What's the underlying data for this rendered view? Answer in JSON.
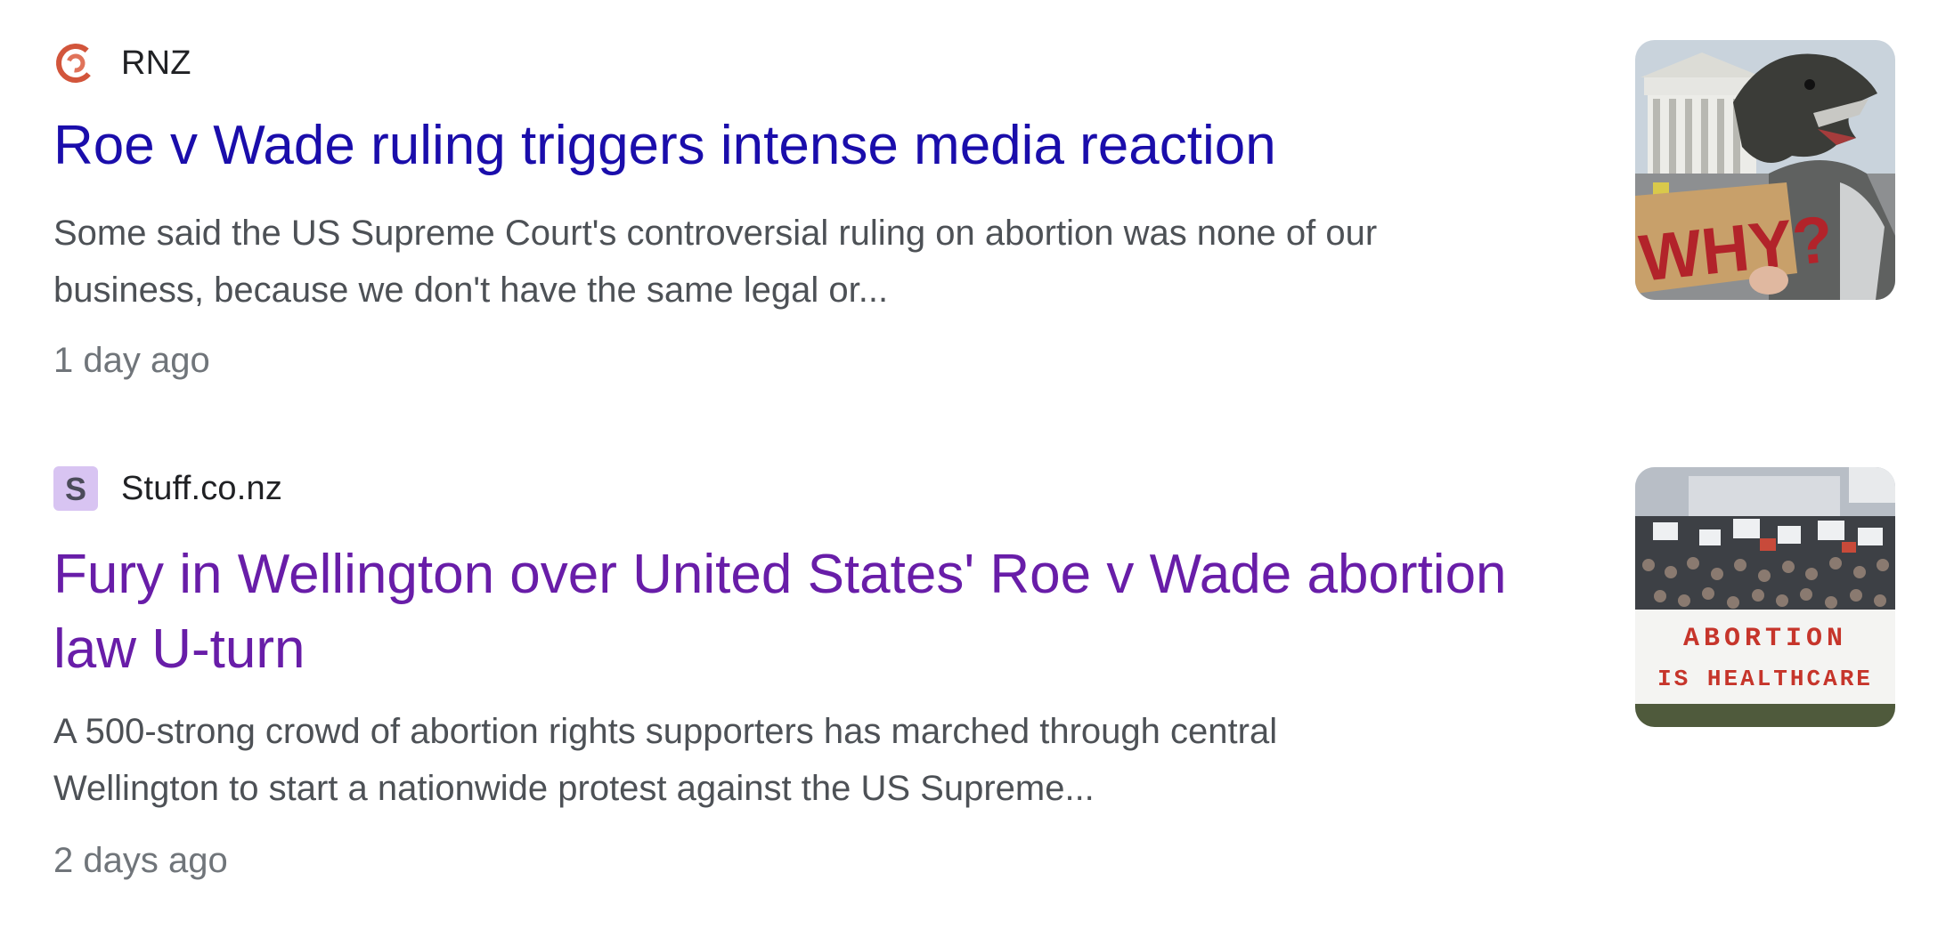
{
  "results": [
    {
      "source": "RNZ",
      "favicon": "rnz-swirl-icon",
      "headline": "Roe v Wade ruling triggers intense media reaction",
      "snippet_line1": "Some said the US Supreme Court's controversial ruling on abortion was none of our",
      "snippet_line2": "business, because we don't have the same legal or...",
      "age": "1 day ago",
      "thumbnail": {
        "icon": "protest-dinosaur-thumbnail",
        "sign_text": "WHY?"
      }
    },
    {
      "source": "Stuff.co.nz",
      "favicon": "stuff-s-icon",
      "headline_line1": "Fury in Wellington over United States' Roe v Wade abortion",
      "headline_line2": "law U-turn",
      "snippet_line1": "A 500-strong crowd of abortion rights supporters has marched through central",
      "snippet_line2": "Wellington to start a nationwide protest against the US Supreme...",
      "age": "2 days ago",
      "thumbnail": {
        "icon": "protest-crowd-thumbnail",
        "banner_line1": "ABORTION",
        "banner_line2": "IS HEALTHCARE"
      }
    }
  ],
  "colors": {
    "link_unvisited": "#1a0dab",
    "link_visited": "#681da8",
    "snippet": "#4d5156",
    "meta": "#70757a"
  }
}
